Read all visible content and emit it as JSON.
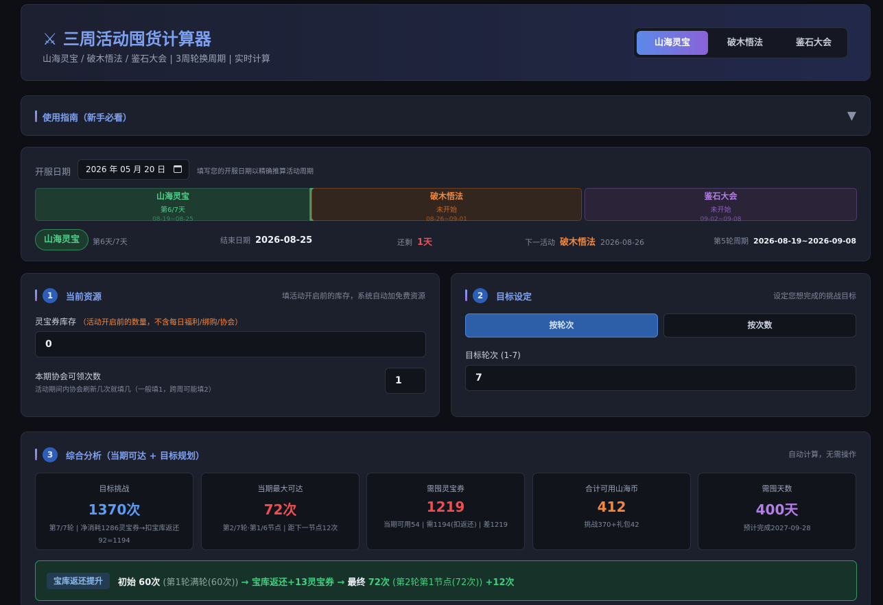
{
  "header": {
    "title": "⚔ 三周活动囤货计算器",
    "subtitle": "山海灵宝 / 破木悟法 / 鉴石大会 | 3周轮换周期 | 实时计算",
    "tabs": [
      {
        "label": "山海灵宝"
      },
      {
        "label": "破木悟法"
      },
      {
        "label": "鉴石大会"
      }
    ],
    "active_tab": "山海灵宝"
  },
  "guide": {
    "title": "使用指南（新手必看）",
    "toggle_icon": "chevron-down-icon"
  },
  "schedule": {
    "open_label": "开服日期",
    "open_date": "2026 年 05 月 20 日",
    "open_hint": "填写您的开服日期以精确推算活动周期",
    "timeline": [
      {
        "name": "山海灵宝",
        "status": "第6/7天",
        "range": "08-19~08-25",
        "color": "#3fcf7f",
        "progress": 0.86
      },
      {
        "name": "破木悟法",
        "status": "未开始",
        "range": "08-26~09-01",
        "color": "#f0883e"
      },
      {
        "name": "鉴石大会",
        "status": "未开始",
        "range": "09-02~09-08",
        "color": "#b37ee6"
      }
    ],
    "current_pill": "山海灵宝",
    "day_text": "第6天/7天",
    "end_label": "结束日期",
    "end_value": "2026-08-25",
    "remain_label": "还剩",
    "remain_value": "1天",
    "next_label": "下一活动",
    "next_value": "破木悟法",
    "next_date": "2026-08-26",
    "cycle_label": "第5轮周期",
    "cycle_value": "2026-08-19~2026-09-08"
  },
  "resources": {
    "step": "1",
    "title": "当前资源",
    "hint": "填活动开启前的库存，系统自动加免费资源",
    "stock_label": "灵宝券库存",
    "stock_note": "（活动开启前的数量，不含每日福利/绑购/协会）",
    "stock_value": "0",
    "guild_label": "本期协会可领次数",
    "guild_note": "活动期间内协会刷新几次就填几（一般填1，跨周可能填2）",
    "guild_value": "1"
  },
  "target": {
    "step": "2",
    "title": "目标设定",
    "hint": "设定您想完成的挑战目标",
    "mode_round": "按轮次",
    "mode_count": "按次数",
    "round_label": "目标轮次 (1-7)",
    "round_value": "7"
  },
  "analysis": {
    "step": "3",
    "title": "综合分析（当期可达 + 目标规划）",
    "hint": "自动计算，无需操作",
    "stats": [
      {
        "label": "目标挑战",
        "value": "1370次",
        "sub": "第7/7轮 | 净消耗1286灵宝券→扣宝库返还92=1194",
        "color": "#5b9cf5"
      },
      {
        "label": "当期最大可达",
        "value": "72次",
        "sub": "第2/7轮·第1/6节点 | 距下一节点12次",
        "color": "#f04e4e"
      },
      {
        "label": "需囤灵宝券",
        "value": "1219",
        "sub": "当期可用54 | 需1194(扣返还) | 差1219",
        "color": "#f04e4e"
      },
      {
        "label": "合计可用山海币",
        "value": "412",
        "sub": "挑战370+礼包42",
        "color": "#f0883e"
      },
      {
        "label": "需囤天数",
        "value": "400天",
        "sub": "预计完成2027-09-28",
        "color": "#b37ee6"
      }
    ],
    "banner": {
      "badge": "宝库返还提升",
      "f1": "初始",
      "f2": "60次",
      "f3": "(第1轮满轮(60次))",
      "f4": "→ 宝库返还+13灵宝券 →",
      "f5": "最终",
      "f6": "72次",
      "f7": "(第2轮第1节点(72次))",
      "f8": "+12次"
    }
  }
}
